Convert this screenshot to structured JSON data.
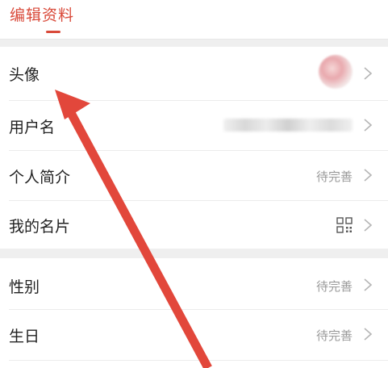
{
  "header": {
    "title": "编辑资料"
  },
  "profile_rows": [
    {
      "label": "头像",
      "value": ""
    },
    {
      "label": "用户名",
      "value": ""
    },
    {
      "label": "个人简介",
      "value": "待完善"
    },
    {
      "label": "我的名片",
      "value": ""
    }
  ],
  "detail_rows": [
    {
      "label": "性别",
      "value": "待完善"
    },
    {
      "label": "生日",
      "value": "待完善"
    }
  ],
  "colors": {
    "accent": "#d94a3a",
    "arrow": "#e2473b",
    "background": "#efefef"
  },
  "icons": {
    "chevron": "chevron-right-icon",
    "qr": "qr-code-icon"
  }
}
